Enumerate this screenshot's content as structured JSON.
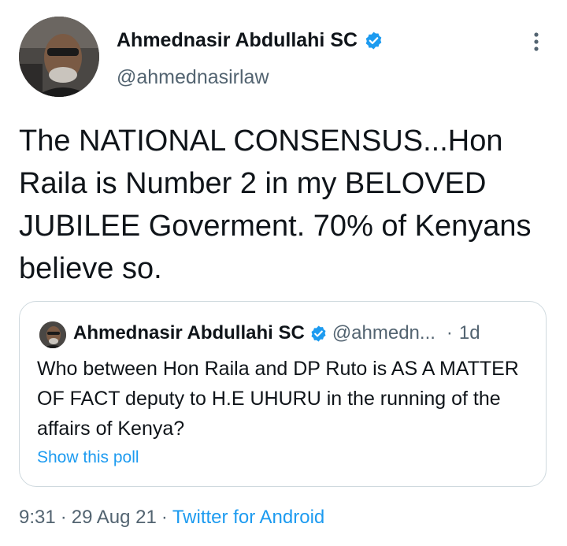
{
  "author": {
    "name": "Ahmednasir Abdullahi SC",
    "handle": "@ahmednasirlaw"
  },
  "tweet": {
    "text": "The NATIONAL CONSENSUS...Hon Raila is Number 2 in my BELOVED JUBILEE Goverment. 70% of Kenyans believe so."
  },
  "quoted_tweet": {
    "name": "Ahmednasir Abdullahi SC",
    "handle": "@ahmedn...",
    "dot": "·",
    "time": "1d",
    "text": "Who between Hon Raila and DP Ruto is AS A MATTER OF FACT deputy to H.E UHURU in the running of the affairs of Kenya?",
    "poll_link": "Show this poll"
  },
  "meta": {
    "time": "9:31",
    "sep1": "·",
    "date": "29 Aug 21",
    "sep2": "·",
    "source": "Twitter for Android"
  },
  "colors": {
    "accent": "#1d9bf0",
    "secondary_text": "#536471",
    "primary_text": "#0f1419",
    "border": "#cfd9de"
  },
  "icons": {
    "verified": "verified-badge-icon",
    "more": "more-vertical-icon"
  }
}
